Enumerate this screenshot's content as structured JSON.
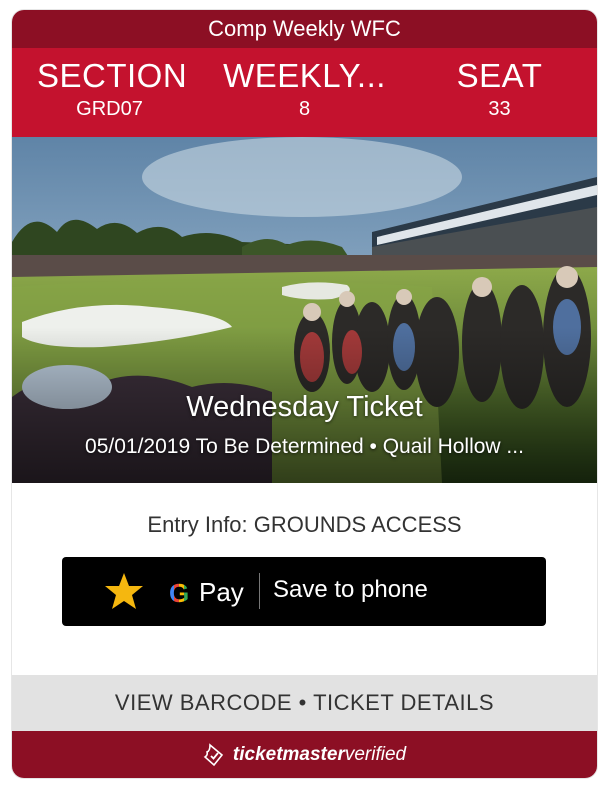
{
  "ticket": {
    "event_name": "Comp Weekly WFC",
    "section_label": "SECTION",
    "section_value": "GRD07",
    "row_label": "WEEKLY...",
    "row_value": "8",
    "seat_label": "SEAT",
    "seat_value": "33",
    "title": "Wednesday Ticket",
    "subtitle": "05/01/2019 To Be Determined • Quail Hollow ...",
    "entry_info": "Entry Info: GROUNDS ACCESS"
  },
  "gpay_button": {
    "g_letter": "G",
    "pay_label": "Pay",
    "save_label": "Save to phone"
  },
  "footer": {
    "barcode_details": "VIEW BARCODE • TICKET DETAILS",
    "brand_bold": "ticketmaster",
    "brand_light": "verified"
  },
  "colors": {
    "header_dark_red": "#8c0f24",
    "seat_bar_red": "#c4122e",
    "gpay_black": "#000000",
    "star_gold": "#f5b70f",
    "barcode_gray": "#e2e2e2"
  },
  "icons": [
    "star-icon",
    "ticketmaster-verified-icon"
  ]
}
